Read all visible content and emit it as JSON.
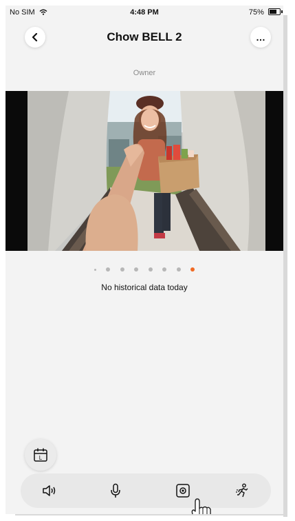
{
  "status_bar": {
    "carrier": "No SIM",
    "time": "4:48 PM",
    "battery": "75%"
  },
  "header": {
    "title": "Chow BELL 2",
    "back_icon": "chevron-left-icon",
    "more_icon": "more-horizontal-icon",
    "more_label": "…"
  },
  "role_label": "Owner",
  "camera": {
    "pages": 8,
    "active_page": 8
  },
  "history": {
    "empty_text": "No historical data today"
  },
  "calendar_button": {
    "icon": "calendar-icon",
    "letter": "L"
  },
  "toolbar": {
    "items": [
      {
        "icon": "speaker-icon"
      },
      {
        "icon": "microphone-icon"
      },
      {
        "icon": "doorbell-panel-icon"
      },
      {
        "icon": "motion-person-icon"
      }
    ]
  },
  "colors": {
    "accent": "#f06a23",
    "background": "#f3f3f3",
    "toolbar": "#e8e8e8"
  }
}
